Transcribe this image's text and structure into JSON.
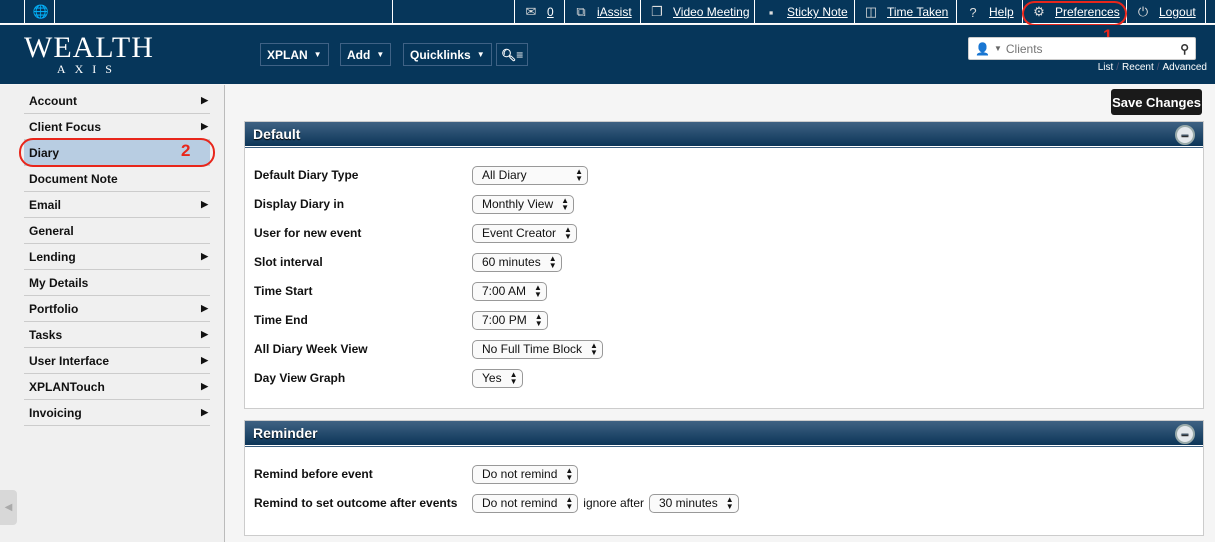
{
  "topbar": {
    "messages_count": "0",
    "iassist": "iAssist",
    "video_meeting": "Video Meeting",
    "sticky_note": "Sticky Note",
    "time_taken": "Time Taken",
    "help": "Help",
    "preferences": "Preferences",
    "logout": "Logout"
  },
  "header": {
    "logo_top": "WEALTH",
    "logo_bottom": "AXIS",
    "nav": [
      "XPLAN",
      "Add",
      "Quicklinks"
    ],
    "search_placeholder": "Clients",
    "links": [
      "List",
      "Recent",
      "Advanced"
    ]
  },
  "annotations": {
    "first": "1",
    "second": "2"
  },
  "sidebar": {
    "items": [
      {
        "label": "Account",
        "submenu": true
      },
      {
        "label": "Client Focus",
        "submenu": true
      },
      {
        "label": "Diary",
        "submenu": false,
        "selected": true
      },
      {
        "label": "Document Note",
        "submenu": false
      },
      {
        "label": "Email",
        "submenu": true
      },
      {
        "label": "General",
        "submenu": false
      },
      {
        "label": "Lending",
        "submenu": true
      },
      {
        "label": "My Details",
        "submenu": false
      },
      {
        "label": "Portfolio",
        "submenu": true
      },
      {
        "label": "Tasks",
        "submenu": true
      },
      {
        "label": "User Interface",
        "submenu": true
      },
      {
        "label": "XPLANTouch",
        "submenu": true
      },
      {
        "label": "Invoicing",
        "submenu": true
      }
    ]
  },
  "save_label": "Save Changes",
  "default_panel": {
    "title": "Default",
    "rows": [
      {
        "label": "Default Diary Type",
        "value": "All Diary"
      },
      {
        "label": "Display Diary in",
        "value": "Monthly View"
      },
      {
        "label": "User for new event",
        "value": "Event Creator"
      },
      {
        "label": "Slot interval",
        "value": "60 minutes"
      },
      {
        "label": "Time Start",
        "value": "7:00 AM"
      },
      {
        "label": "Time End",
        "value": "7:00 PM"
      },
      {
        "label": "All Diary Week View",
        "value": "No Full Time Block"
      },
      {
        "label": "Day View Graph",
        "value": "Yes"
      }
    ]
  },
  "reminder_panel": {
    "title": "Reminder",
    "rows": [
      {
        "label": "Remind before event",
        "value": "Do not remind"
      },
      {
        "label": "Remind to set outcome after events",
        "value": "Do not remind",
        "extra_text": "ignore after",
        "extra_value": "30 minutes"
      }
    ]
  }
}
